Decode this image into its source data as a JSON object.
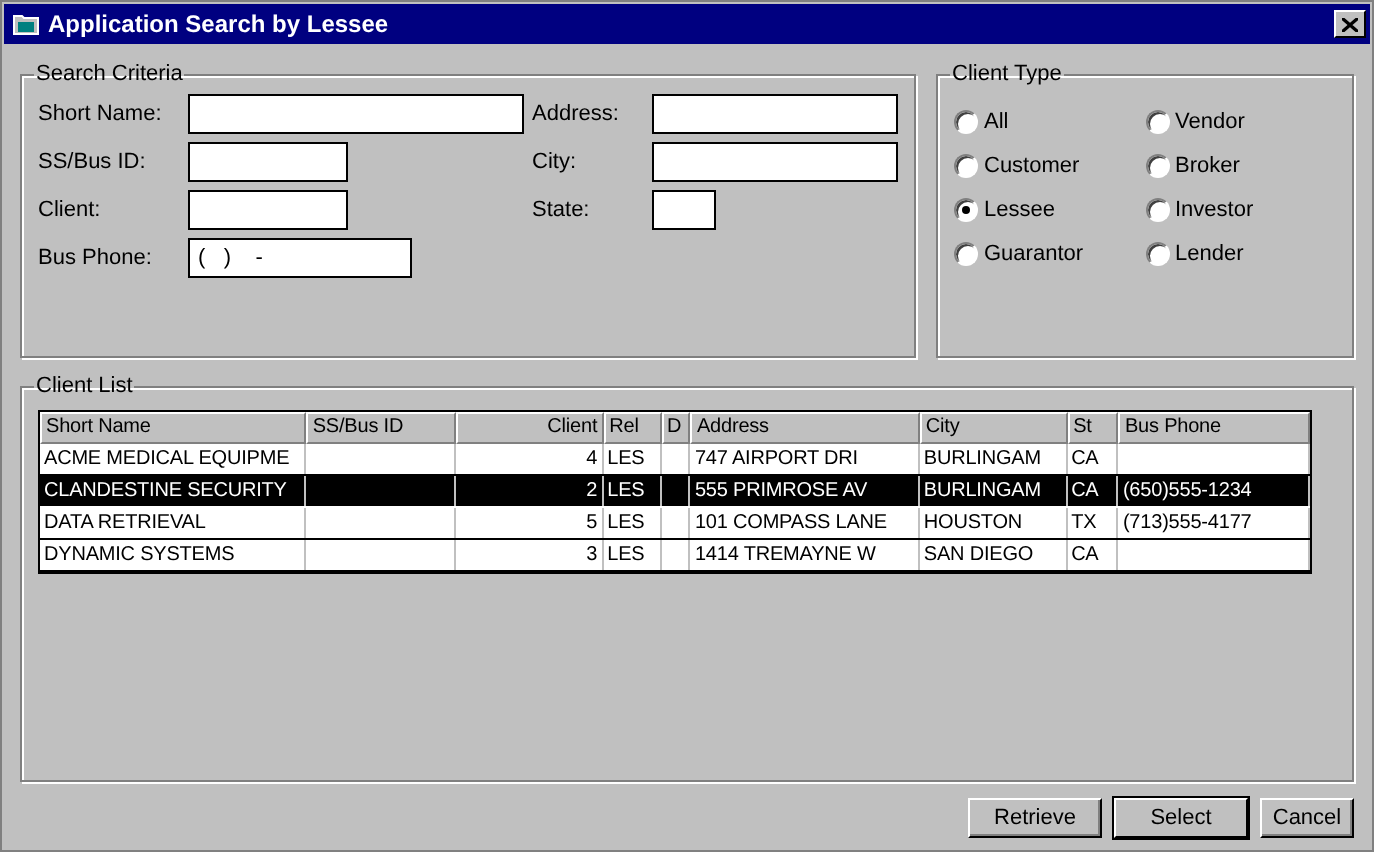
{
  "window": {
    "title": "Application Search by Lessee"
  },
  "search_criteria": {
    "title": "Search Criteria",
    "rows": [
      [
        {
          "label": "Short Name:",
          "kind": "wide"
        },
        {
          "label": "Address:",
          "kind": "wide"
        }
      ],
      [
        {
          "label": "SS/Bus ID:",
          "kind": "medium"
        },
        {
          "label": "City:",
          "kind": "wide"
        }
      ],
      [
        {
          "label": "Client:",
          "kind": "medium"
        },
        {
          "label": "State:",
          "kind": "small"
        }
      ],
      [
        {
          "label": "Bus Phone:",
          "kind": "phone",
          "value": "(   )    -"
        }
      ]
    ]
  },
  "client_type": {
    "title": "Client Type",
    "options": [
      {
        "label": "All",
        "selected": false
      },
      {
        "label": "Vendor",
        "selected": false
      },
      {
        "label": "Customer",
        "selected": false
      },
      {
        "label": "Broker",
        "selected": false
      },
      {
        "label": "Lessee",
        "selected": true
      },
      {
        "label": "Investor",
        "selected": false
      },
      {
        "label": "Guarantor",
        "selected": false
      },
      {
        "label": "Lender",
        "selected": false
      }
    ]
  },
  "client_list": {
    "title": "Client List",
    "columns": [
      {
        "label": "Short Name",
        "numeric": false
      },
      {
        "label": "SS/Bus ID",
        "numeric": false
      },
      {
        "label": "Client",
        "numeric": true
      },
      {
        "label": "Rel",
        "numeric": false
      },
      {
        "label": "D",
        "numeric": false
      },
      {
        "label": "Address",
        "numeric": false
      },
      {
        "label": "City",
        "numeric": false
      },
      {
        "label": "St",
        "numeric": false
      },
      {
        "label": "Bus Phone",
        "numeric": false
      }
    ],
    "rows": [
      {
        "selected": false,
        "cells": [
          "ACME MEDICAL EQUIPME",
          "",
          "4",
          "LES",
          "",
          "747 AIRPORT DRI",
          "BURLINGAM",
          "CA",
          ""
        ]
      },
      {
        "selected": true,
        "cells": [
          "CLANDESTINE SECURITY",
          "",
          "2",
          "LES",
          "",
          "555 PRIMROSE AV",
          "BURLINGAM",
          "CA",
          "(650)555-1234"
        ]
      },
      {
        "selected": false,
        "cells": [
          "DATA RETRIEVAL",
          "",
          "5",
          "LES",
          "",
          "101 COMPASS LANE",
          "HOUSTON",
          "TX",
          "(713)555-4177"
        ]
      },
      {
        "selected": false,
        "cells": [
          "DYNAMIC SYSTEMS",
          "",
          "3",
          "LES",
          "",
          "1414 TREMAYNE W",
          "SAN DIEGO",
          "CA",
          ""
        ]
      }
    ]
  },
  "buttons": [
    {
      "label": "Retrieve",
      "default": false
    },
    {
      "label": "Select",
      "default": true
    },
    {
      "label": "Cancel",
      "default": false
    }
  ]
}
